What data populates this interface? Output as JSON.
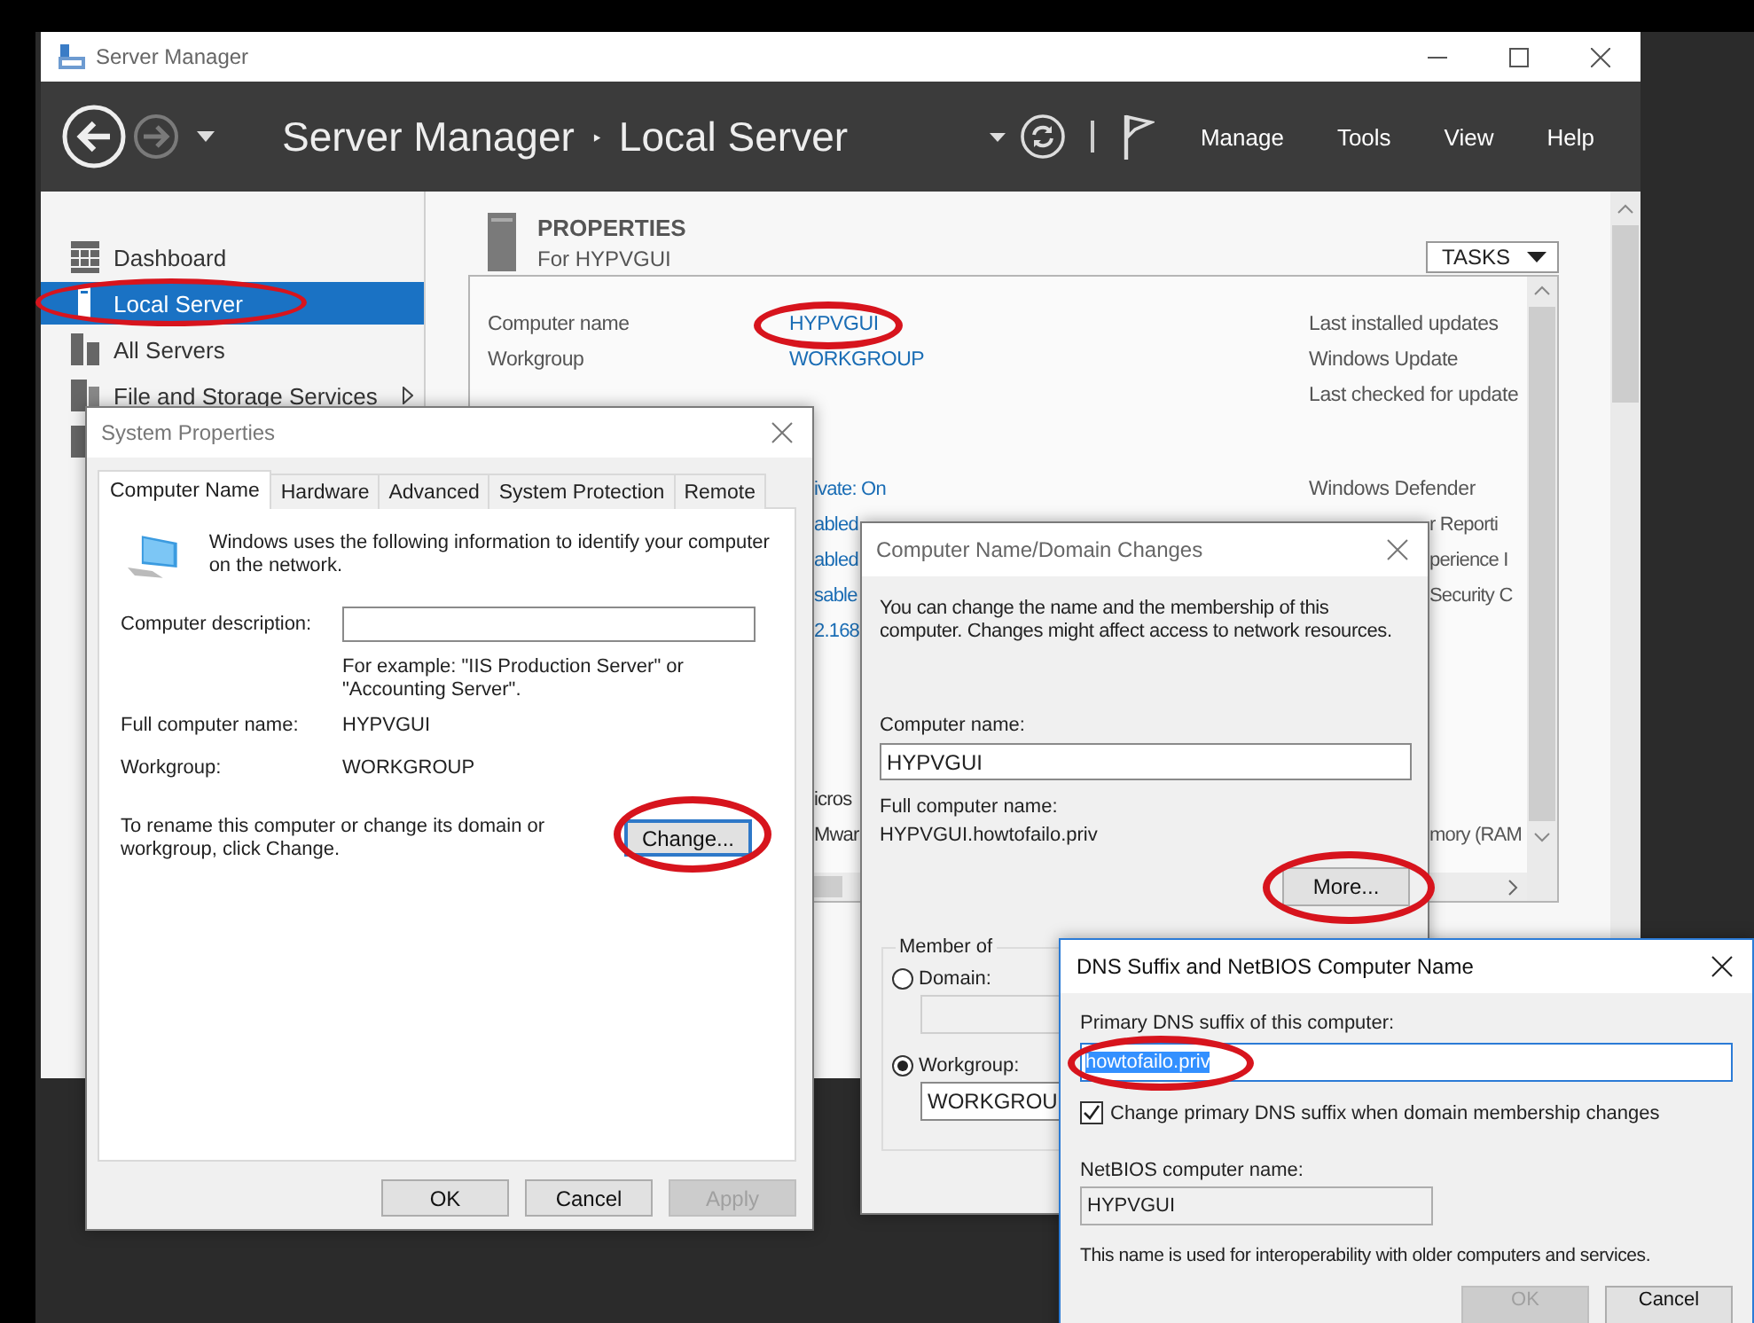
{
  "server_manager": {
    "window": {
      "title": "Server Manager"
    },
    "header": {
      "breadcrumb": [
        "Server Manager",
        "Local Server"
      ],
      "separator": "‣",
      "menus": [
        "Manage",
        "Tools",
        "View",
        "Help"
      ]
    },
    "sidebar": {
      "items": [
        {
          "label": "Dashboard",
          "selected": false,
          "expandable": false
        },
        {
          "label": "Local Server",
          "selected": true,
          "expandable": false
        },
        {
          "label": "All Servers",
          "selected": false,
          "expandable": false
        },
        {
          "label": "File and Storage Services",
          "selected": false,
          "expandable": true
        },
        {
          "selected": false
        }
      ]
    },
    "properties": {
      "title": "PROPERTIES",
      "subtitle": "For HYPVGUI",
      "tasks_button": "TASKS",
      "groups": [
        {
          "rows": [
            {
              "label": "Computer name",
              "value": "HYPVGUI",
              "link": true,
              "right": "Last installed updates"
            },
            {
              "label": "Workgroup",
              "value": "WORKGROUP",
              "link": true,
              "right": "Windows Update"
            },
            {
              "right": "Last checked for update"
            }
          ]
        },
        {
          "rows": [
            {
              "value": "ivate: On",
              "link": true,
              "partial": true,
              "right": "Windows Defender"
            },
            {
              "value": "abled",
              "link": true,
              "partial": true,
              "right": "r Reporti",
              "right_partial": true
            },
            {
              "value": "abled",
              "link": true,
              "partial": true,
              "right": "perience I",
              "right_partial": true
            },
            {
              "value": "sable",
              "link": true,
              "partial": true,
              "right": "Security C",
              "right_partial": true
            },
            {
              "value": "2.168",
              "link": true,
              "partial": true
            }
          ]
        },
        {
          "rows": [
            {
              "value": "icros",
              "link": false,
              "partial": true
            },
            {
              "value": "Mwar",
              "link": false,
              "partial": true,
              "right": "mory (RAM",
              "right_partial": true
            }
          ]
        }
      ]
    }
  },
  "system_properties": {
    "title": "System Properties",
    "tabs": [
      {
        "label": "Computer Name",
        "selected": true
      },
      {
        "label": "Hardware",
        "selected": false
      },
      {
        "label": "Advanced",
        "selected": false
      },
      {
        "label": "System Protection",
        "selected": false
      },
      {
        "label": "Remote",
        "selected": false
      }
    ],
    "intro": "Windows uses the following information to identify your computer on the network.",
    "description_label": "Computer description:",
    "description_hint": "For example: \"IIS Production Server\" or \"Accounting Server\".",
    "full_name_label": "Full computer name:",
    "full_name_value": "HYPVGUI",
    "workgroup_label": "Workgroup:",
    "workgroup_value": "WORKGROUP",
    "rename_text": "To rename this computer or change its domain or workgroup, click Change.",
    "change_button": "Change...",
    "buttons": [
      {
        "label": "OK",
        "disabled": false
      },
      {
        "label": "Cancel",
        "disabled": false
      },
      {
        "label": "Apply",
        "disabled": true
      }
    ]
  },
  "computer_name_changes": {
    "title": "Computer Name/Domain Changes",
    "intro": "You can change the name and the membership of this computer. Changes might affect access to network resources.",
    "name_label": "Computer name:",
    "name_value": "HYPVGUI",
    "full_label": "Full computer name:",
    "full_value": "HYPVGUI.howtofailo.priv",
    "more_button": "More...",
    "member_of": {
      "legend": "Member of",
      "options": [
        {
          "label": "Domain:",
          "selected": false
        },
        {
          "label": "Workgroup:",
          "selected": true,
          "field_value": "WORKGROU"
        }
      ]
    }
  },
  "dns_suffix": {
    "title": "DNS Suffix and NetBIOS Computer Name",
    "suffix_label": "Primary DNS suffix of this computer:",
    "suffix_value": "howtofailo.priv",
    "suffix_selected": true,
    "checkbox": {
      "label": "Change primary DNS suffix when domain membership changes",
      "checked": true
    },
    "netbios_label": "NetBIOS computer name:",
    "netbios_value": "HYPVGUI",
    "note": "This name is used for interoperability with older computers and services.",
    "buttons": [
      {
        "label": "OK",
        "disabled": true
      },
      {
        "label": "Cancel",
        "disabled": false
      }
    ]
  }
}
